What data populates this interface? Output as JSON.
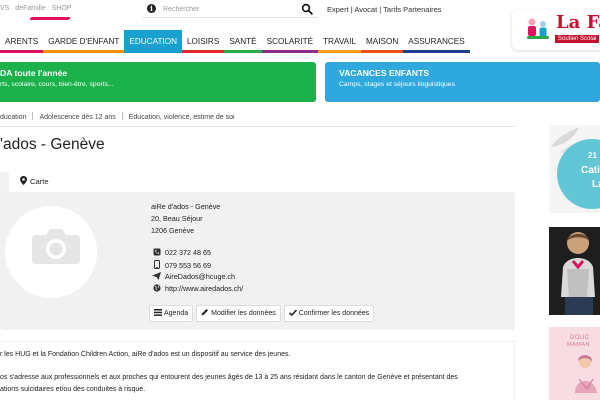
{
  "top": {
    "links": [
      "VS",
      "deFamille",
      "SHOP"
    ],
    "search_placeholder": "Rechercher",
    "partners": [
      "Expert",
      "Avocat",
      "Tarifs Partenaires"
    ],
    "partners_sep": " | "
  },
  "logo": {
    "name": "La Fam",
    "tagline": "Soutien Scolai"
  },
  "nav": [
    {
      "label": "ARENTS",
      "color": "#e0115f"
    },
    {
      "label": "GARDE D'ENFANT",
      "color": "#f39200"
    },
    {
      "label": "EDUCATION",
      "color": "#1aa0cf",
      "active": true
    },
    {
      "label": "LOISIRS",
      "color": "#e7262b"
    },
    {
      "label": "SANTÉ",
      "color": "#2aa84a"
    },
    {
      "label": "SCOLARITÉ",
      "color": "#8a2b8f"
    },
    {
      "label": "TRAVAIL",
      "color": "#f6a01a"
    },
    {
      "label": "MAISON",
      "color": "#e94e1b"
    },
    {
      "label": "ASSURANCES",
      "color": "#1e3f8f"
    }
  ],
  "banners": {
    "left_title": "DA toute l'année",
    "left_sub": "rts, scolaire, cours, bien-être, sports...",
    "right_title": "VACANCES ENFANTS",
    "right_sub": "Camps, stages et séjours linguistiques"
  },
  "breadcrumb": [
    "ducation",
    "Adolescence dès 12 ans",
    "Education, violence, estime de soi"
  ],
  "title": "'ados - Genève",
  "tabs": {
    "map_label": "Carte"
  },
  "card": {
    "org_name": "aiRe d'ados - Genève",
    "street": "20, Beau Séjour",
    "city": "1206 Genève",
    "phone": "022 372 48 65",
    "mobile": "079 553 56 69",
    "email": "AireDados@hcuge.ch",
    "website": "http://www.airedados.ch/",
    "buttons": {
      "agenda": "Agenda",
      "edit": "Modifier les données",
      "confirm": "Confirmer les données"
    }
  },
  "description": [
    "r les HUG et la Fondation Children Action, aiRe d'ados est un dispositif au service des jeunes.",
    "os s'adresse aux professionnels et aux proches qui entourent des jeunes âgés de 13 à 25 ans résidant dans le canton de Genève et présentant des",
    "ations suicidaires et/ou des conduites à risque."
  ],
  "ads": {
    "ad1_line1": "21",
    "ad1_line2": "Cati",
    "ad1_line3": "La",
    "ad3_line1": "DOUC",
    "ad3_line2": "MAMAN"
  },
  "colors": {
    "nav_active": "#1aa0cf",
    "banner_green": "#1bb14b",
    "banner_blue": "#2fa9dd",
    "brand_red": "#c4122f"
  }
}
